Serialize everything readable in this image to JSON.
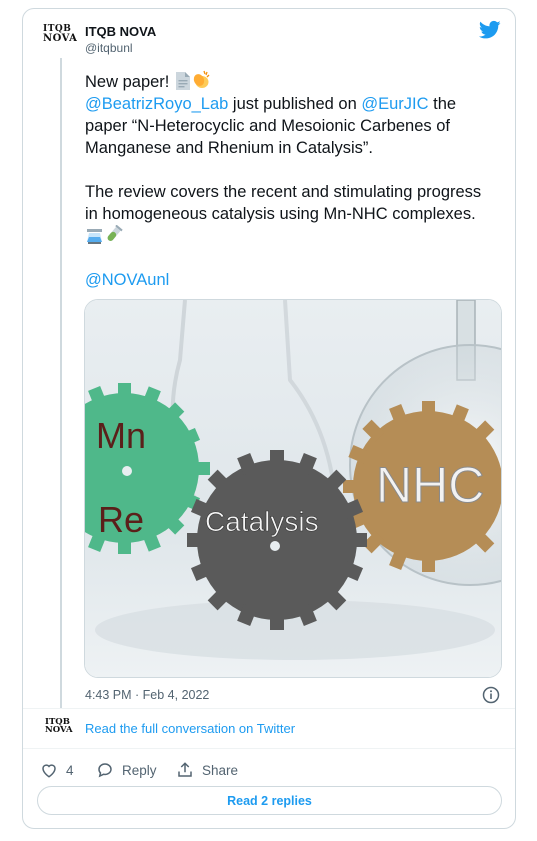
{
  "author": {
    "name": "ITQB NOVA",
    "handle": "@itqbunl",
    "avatar_text_top": "ITQB",
    "avatar_text_bottom": "NOVA"
  },
  "tweet": {
    "line1_text": "New paper! ",
    "line2_link1": "@BeatrizRoyo_Lab",
    "line2_text": " just published on ",
    "line2_link2": "@EurJIC",
    "line2_text_end": " the paper “N-Heterocyclic and Mesoionic Carbenes of Manganese and Rhenium in Catalysis”.",
    "para2": "The review covers the recent and stimulating progress in homogeneous catalysis using Mn-NHC complexes. ",
    "mention": "@NOVAunl"
  },
  "image": {
    "gear_left_top": "Mn",
    "gear_left_bottom": "Re",
    "gear_center": "Catalysis",
    "gear_right": "NHC",
    "colors": {
      "green": "#4fb88a",
      "grey": "#5a5a5a",
      "gold": "#b58d56"
    }
  },
  "meta": {
    "timestamp": "4:43 PM · Feb 4, 2022"
  },
  "conversation": {
    "read_full": "Read the full conversation on Twitter"
  },
  "actions": {
    "like_count": "4",
    "reply_label": "Reply",
    "share_label": "Share"
  },
  "replies_button": "Read 2 replies",
  "icons": [
    "twitter-bird-icon",
    "document-icon",
    "clapping-hands-icon",
    "alembic-icon",
    "test-tube-icon",
    "info-icon",
    "heart-icon",
    "reply-icon",
    "share-icon"
  ],
  "accent_color": "#1d9bf0"
}
